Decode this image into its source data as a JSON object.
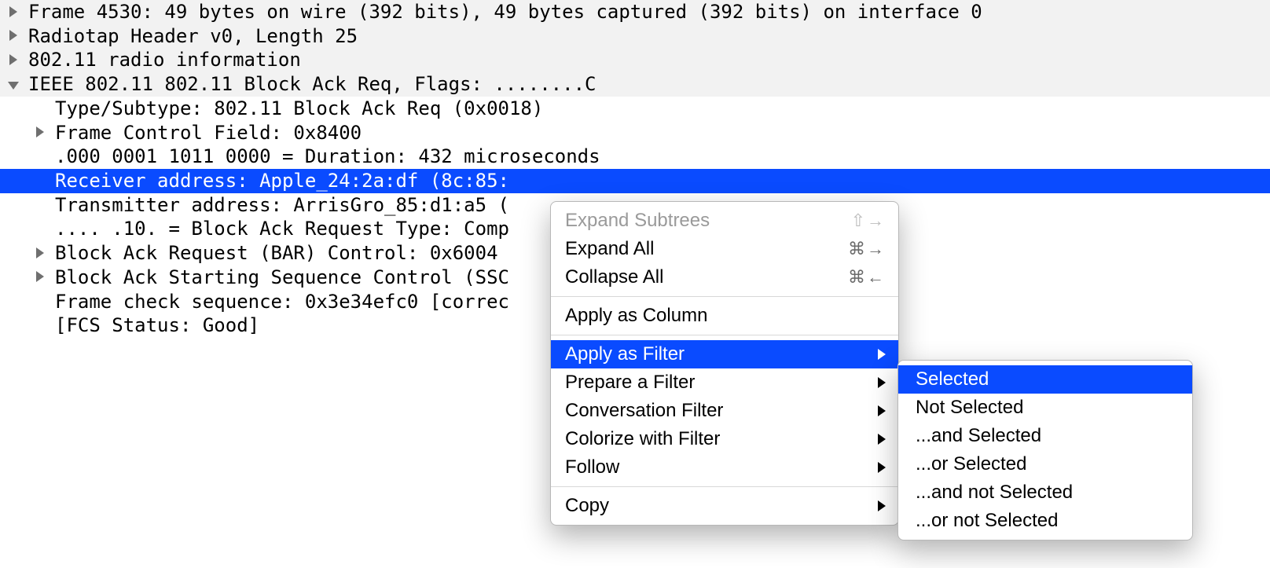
{
  "tree": {
    "rows": [
      {
        "indent": 0,
        "toggle": "right",
        "toplevel": true,
        "selected": false,
        "text": "Frame 4530: 49 bytes on wire (392 bits), 49 bytes captured (392 bits) on interface 0",
        "name": "row-frame"
      },
      {
        "indent": 0,
        "toggle": "right",
        "toplevel": true,
        "selected": false,
        "text": "Radiotap Header v0, Length 25",
        "name": "row-radiotap"
      },
      {
        "indent": 0,
        "toggle": "right",
        "toplevel": true,
        "selected": false,
        "text": "802.11 radio information",
        "name": "row-radio-info"
      },
      {
        "indent": 0,
        "toggle": "down",
        "toplevel": true,
        "selected": false,
        "text": "IEEE 802.11 802.11 Block Ack Req, Flags: ........C",
        "name": "row-ieee80211"
      },
      {
        "indent": 1,
        "toggle": "none",
        "toplevel": false,
        "selected": false,
        "text": "Type/Subtype: 802.11 Block Ack Req (0x0018)",
        "name": "row-type-subtype"
      },
      {
        "indent": 1,
        "toggle": "right",
        "toplevel": false,
        "selected": false,
        "text": "Frame Control Field: 0x8400",
        "name": "row-frame-control"
      },
      {
        "indent": 1,
        "toggle": "none",
        "toplevel": false,
        "selected": false,
        "text": ".000 0001 1011 0000 = Duration: 432 microseconds",
        "name": "row-duration"
      },
      {
        "indent": 1,
        "toggle": "none",
        "toplevel": false,
        "selected": true,
        "text": "Receiver address: Apple_24:2a:df (8c:85:",
        "name": "row-receiver-address"
      },
      {
        "indent": 1,
        "toggle": "none",
        "toplevel": false,
        "selected": false,
        "text": "Transmitter address: ArrisGro_85:d1:a5 (",
        "name": "row-transmitter-address"
      },
      {
        "indent": 1,
        "toggle": "none",
        "toplevel": false,
        "selected": false,
        "text": ".... .10. = Block Ack Request Type: Comp",
        "name": "row-bar-type"
      },
      {
        "indent": 1,
        "toggle": "right",
        "toplevel": false,
        "selected": false,
        "text": "Block Ack Request (BAR) Control: 0x6004",
        "name": "row-bar-control"
      },
      {
        "indent": 1,
        "toggle": "right",
        "toplevel": false,
        "selected": false,
        "text": "Block Ack Starting Sequence Control (SSC",
        "name": "row-ssc"
      },
      {
        "indent": 1,
        "toggle": "none",
        "toplevel": false,
        "selected": false,
        "text": "Frame check sequence: 0x3e34efc0 [correc",
        "name": "row-fcs"
      },
      {
        "indent": 1,
        "toggle": "none",
        "toplevel": false,
        "selected": false,
        "text": "[FCS Status: Good]",
        "name": "row-fcs-status"
      }
    ]
  },
  "context_menu": {
    "items": [
      {
        "label": "Expand Subtrees",
        "shortcut": "⇧→",
        "disabled": true,
        "submenu": false,
        "highlight": false
      },
      {
        "label": "Expand All",
        "shortcut": "⌘→",
        "disabled": false,
        "submenu": false,
        "highlight": false
      },
      {
        "label": "Collapse All",
        "shortcut": "⌘←",
        "disabled": false,
        "submenu": false,
        "highlight": false
      },
      {
        "separator": true
      },
      {
        "label": "Apply as Column",
        "shortcut": "",
        "disabled": false,
        "submenu": false,
        "highlight": false
      },
      {
        "separator": true
      },
      {
        "label": "Apply as Filter",
        "shortcut": "",
        "disabled": false,
        "submenu": true,
        "highlight": true
      },
      {
        "label": "Prepare a Filter",
        "shortcut": "",
        "disabled": false,
        "submenu": true,
        "highlight": false
      },
      {
        "label": "Conversation Filter",
        "shortcut": "",
        "disabled": false,
        "submenu": true,
        "highlight": false
      },
      {
        "label": "Colorize with Filter",
        "shortcut": "",
        "disabled": false,
        "submenu": true,
        "highlight": false
      },
      {
        "label": "Follow",
        "shortcut": "",
        "disabled": false,
        "submenu": true,
        "highlight": false
      },
      {
        "separator": true
      },
      {
        "label": "Copy",
        "shortcut": "",
        "disabled": false,
        "submenu": true,
        "highlight": false
      }
    ]
  },
  "submenu": {
    "items": [
      {
        "label": "Selected",
        "highlight": true
      },
      {
        "label": "Not Selected",
        "highlight": false
      },
      {
        "label": "...and Selected",
        "highlight": false
      },
      {
        "label": "...or Selected",
        "highlight": false
      },
      {
        "label": "...and not Selected",
        "highlight": false
      },
      {
        "label": "...or not Selected",
        "highlight": false
      }
    ]
  }
}
